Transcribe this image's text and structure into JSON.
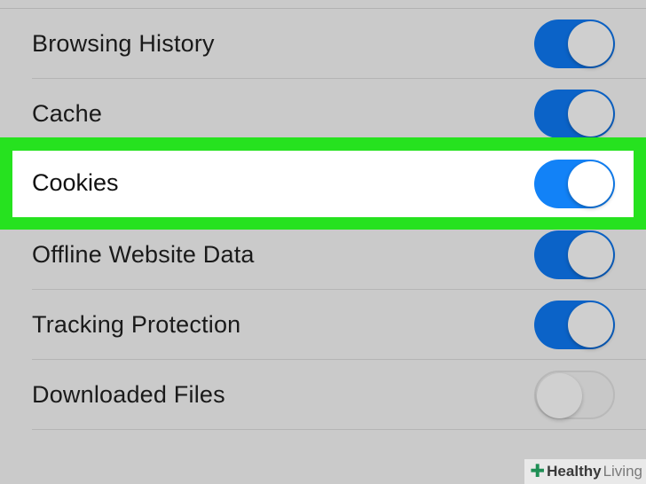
{
  "settings": {
    "items": [
      {
        "label": "Browsing History",
        "state": "on"
      },
      {
        "label": "Cache",
        "state": "on"
      },
      {
        "label": "Cookies",
        "state": "on"
      },
      {
        "label": "Offline Website Data",
        "state": "on"
      },
      {
        "label": "Tracking Protection",
        "state": "on"
      },
      {
        "label": "Downloaded Files",
        "state": "off"
      }
    ]
  },
  "highlight": {
    "item_index": 2,
    "color": "#26e21f"
  },
  "colors": {
    "toggle_on": "#0b63c8",
    "toggle_on_highlight": "#1282f7",
    "background": "#cacaca"
  },
  "watermark": {
    "icon": "plus-cross-icon",
    "word1": "Healthy",
    "word2": "Living"
  }
}
